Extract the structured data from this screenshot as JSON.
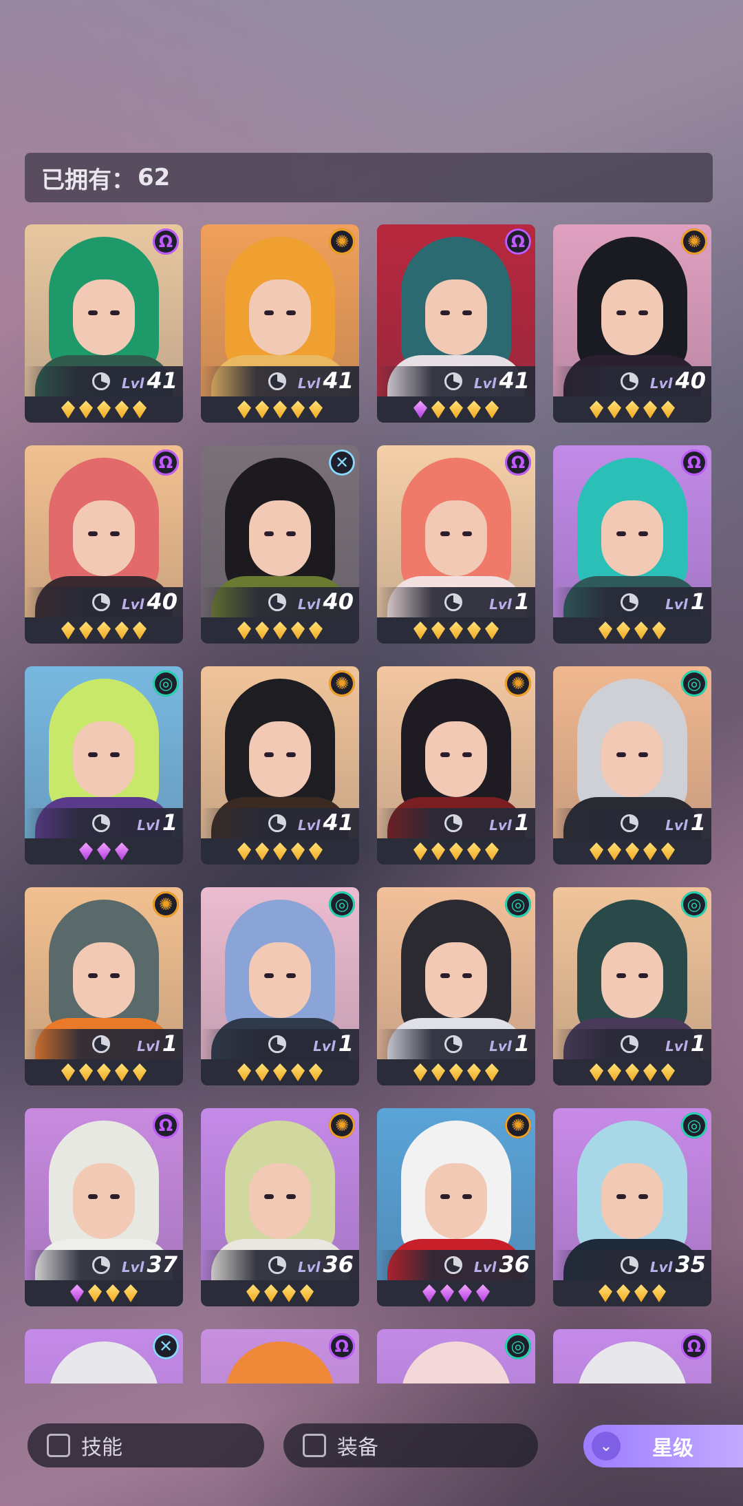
{
  "owned": {
    "label": "已拥有：",
    "count": "62"
  },
  "level_label": "Lvl",
  "colors": {
    "element_light": "#c05cff",
    "element_sun": "#f0a020",
    "element_wind": "#24d4b0",
    "element_dark": "#8ad8ff",
    "star_gold": "#f7c23a",
    "star_purple": "#c552f0",
    "sort_accent": "#a88cff"
  },
  "heroes": [
    {
      "element": "light",
      "level": "41",
      "stars": [
        "gold",
        "gold",
        "gold",
        "gold",
        "gold"
      ],
      "bg": "#e8c7a0",
      "hair": "#1e9a6a",
      "body": "#2f5a4c"
    },
    {
      "element": "sun",
      "level": "41",
      "stars": [
        "gold",
        "gold",
        "gold",
        "gold",
        "gold"
      ],
      "bg": "#f0a05a",
      "hair": "#f0a030",
      "body": "#e9b860"
    },
    {
      "element": "light",
      "level": "41",
      "stars": [
        "purple",
        "gold",
        "gold",
        "gold",
        "gold"
      ],
      "bg": "#b8283e",
      "hair": "#2a6a70",
      "body": "#e6dfe4"
    },
    {
      "element": "sun",
      "level": "40",
      "stars": [
        "gold",
        "gold",
        "gold",
        "gold",
        "gold"
      ],
      "bg": "#e0a0c0",
      "hair": "#1a1a22",
      "body": "#2a2030"
    },
    {
      "element": "light",
      "level": "40",
      "stars": [
        "gold",
        "gold",
        "gold",
        "gold",
        "gold"
      ],
      "bg": "#f2c090",
      "hair": "#e26a6a",
      "body": "#3a2a30"
    },
    {
      "element": "dark",
      "level": "40",
      "stars": [
        "gold",
        "gold",
        "gold",
        "gold",
        "gold"
      ],
      "bg": "#7a7078",
      "hair": "#1c1a1e",
      "body": "#6a7a30"
    },
    {
      "element": "light",
      "level": "1",
      "stars": [
        "gold",
        "gold",
        "gold",
        "gold",
        "gold"
      ],
      "bg": "#f4cfa8",
      "hair": "#ef7a6a",
      "body": "#f3e0e0"
    },
    {
      "element": "light",
      "level": "1",
      "stars": [
        "gold",
        "gold",
        "gold",
        "gold"
      ],
      "bg": "#c28ae8",
      "hair": "#2ac0b8",
      "body": "#2e5a5a"
    },
    {
      "element": "wind",
      "level": "1",
      "stars": [
        "purple",
        "purple",
        "purple"
      ],
      "bg": "#78b8e0",
      "hair": "#c8e86a",
      "body": "#5a3a8a"
    },
    {
      "element": "sun",
      "level": "41",
      "stars": [
        "gold",
        "gold",
        "gold",
        "gold",
        "gold"
      ],
      "bg": "#f0c49a",
      "hair": "#1e1e22",
      "body": "#3a2a22"
    },
    {
      "element": "sun",
      "level": "1",
      "stars": [
        "gold",
        "gold",
        "gold",
        "gold",
        "gold"
      ],
      "bg": "#f2c6a0",
      "hair": "#1e1c22",
      "body": "#7a1e22"
    },
    {
      "element": "wind",
      "level": "1",
      "stars": [
        "gold",
        "gold",
        "gold",
        "gold",
        "gold"
      ],
      "bg": "#f0b890",
      "hair": "#cfcfd6",
      "body": "#2a2a32"
    },
    {
      "element": "sun",
      "level": "1",
      "stars": [
        "gold",
        "gold",
        "gold",
        "gold",
        "gold"
      ],
      "bg": "#f2c090",
      "hair": "#5a6a6a",
      "body": "#e87a2a"
    },
    {
      "element": "wind",
      "level": "1",
      "stars": [
        "gold",
        "gold",
        "gold",
        "gold",
        "gold"
      ],
      "bg": "#ecbcd0",
      "hair": "#8aa4d8",
      "body": "#2e3a4a"
    },
    {
      "element": "wind",
      "level": "1",
      "stars": [
        "gold",
        "gold",
        "gold",
        "gold",
        "gold"
      ],
      "bg": "#f2c09a",
      "hair": "#2a2a30",
      "body": "#e0e0e8"
    },
    {
      "element": "wind",
      "level": "1",
      "stars": [
        "gold",
        "gold",
        "gold",
        "gold",
        "gold"
      ],
      "bg": "#f0c49a",
      "hair": "#2a4a4a",
      "body": "#4a3a5a"
    },
    {
      "element": "light",
      "level": "37",
      "stars": [
        "purple",
        "gold",
        "gold",
        "gold"
      ],
      "bg": "#c88ae0",
      "hair": "#e8e8e2",
      "body": "#eeeeea"
    },
    {
      "element": "sun",
      "level": "36",
      "stars": [
        "gold",
        "gold",
        "gold",
        "gold"
      ],
      "bg": "#c48ae8",
      "hair": "#d0d8a0",
      "body": "#eae6e0"
    },
    {
      "element": "sun",
      "level": "36",
      "stars": [
        "purple",
        "purple",
        "purple",
        "purple"
      ],
      "bg": "#5aa4d8",
      "hair": "#f2f2f2",
      "body": "#c8202a"
    },
    {
      "element": "wind",
      "level": "35",
      "stars": [
        "gold",
        "gold",
        "gold",
        "gold"
      ],
      "bg": "#c88ae8",
      "hair": "#a8d8e8",
      "body": "#1e2a3a"
    },
    {
      "element": "dark",
      "level": "",
      "stars": [],
      "bg": "#c48ae8",
      "hair": "#e8e8ec",
      "body": "#c0c0c8"
    },
    {
      "element": "light",
      "level": "",
      "stars": [],
      "bg": "#c890e0",
      "hair": "#f0883a",
      "body": "#e8d0a0"
    },
    {
      "element": "wind",
      "level": "",
      "stars": [],
      "bg": "#c28ae6",
      "hair": "#f2d8d8",
      "body": "#d04040"
    },
    {
      "element": "light",
      "level": "",
      "stars": [],
      "bg": "#c48ae8",
      "hair": "#e8e8ec",
      "body": "#f0f0f0"
    }
  ],
  "element_icons": {
    "light": "Ω",
    "sun": "✺",
    "wind": "◎",
    "dark": "✕"
  },
  "filters": {
    "skill_label": "技能",
    "equipment_label": "装备",
    "sort_label": "星级"
  }
}
